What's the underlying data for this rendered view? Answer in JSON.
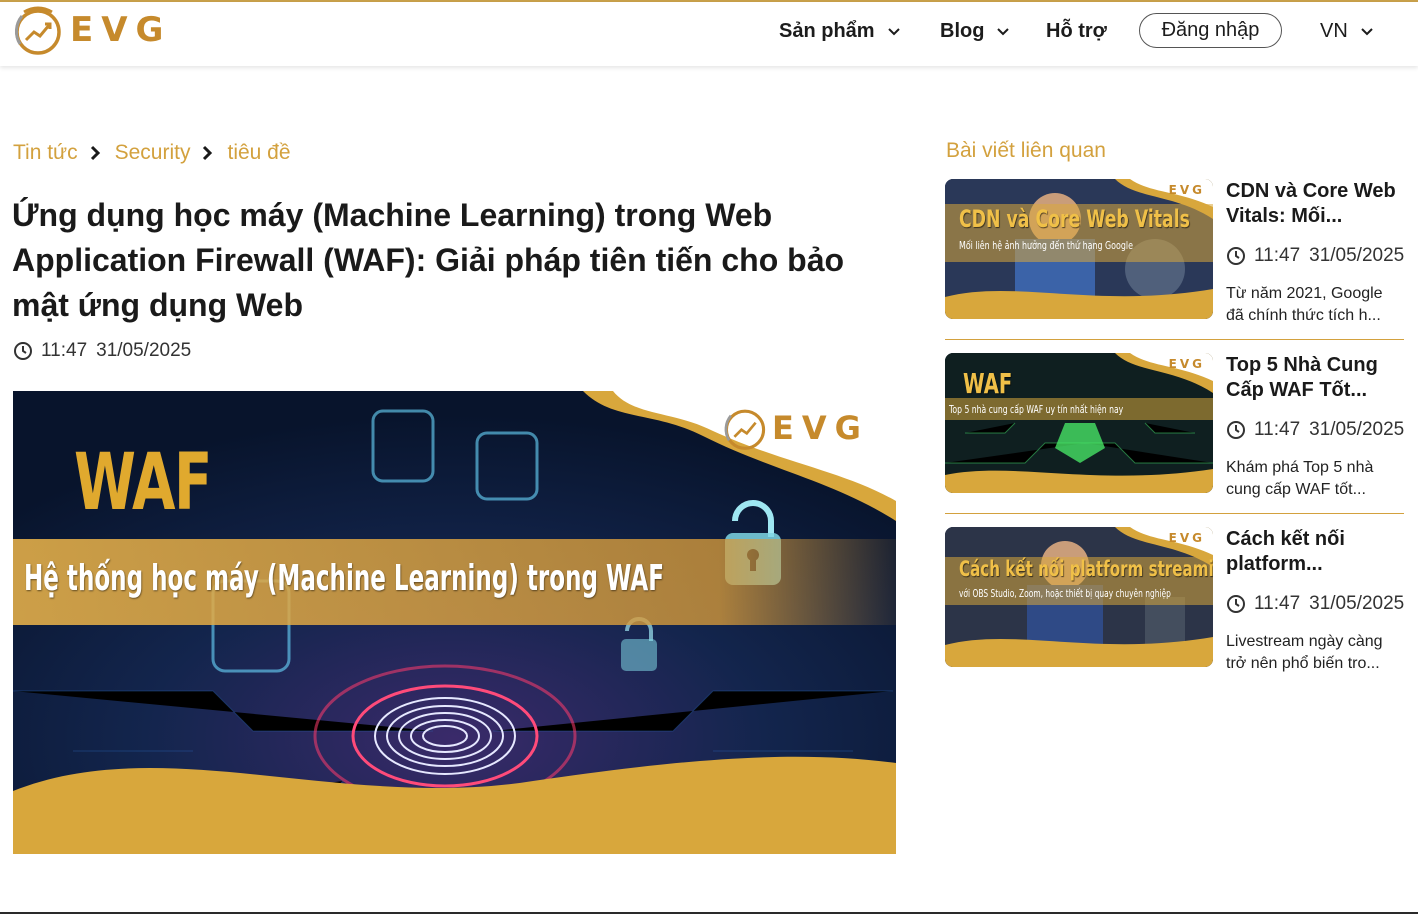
{
  "brand": {
    "logo_text": "EVG",
    "accent_color": "#d3a13e",
    "gold": "#c68a2c"
  },
  "nav": {
    "products": "Sản phẩm",
    "blog": "Blog",
    "support": "Hỗ trợ",
    "login": "Đăng nhập",
    "language": "VN"
  },
  "breadcrumb": {
    "items": [
      "Tin tức",
      "Security",
      "tiêu đề"
    ]
  },
  "article": {
    "title": "Ứng dụng học máy (Machine Learning) trong Web Application Firewall (WAF): Giải pháp tiên tiến cho bảo mật ứng dụng Web",
    "time": "11:47",
    "date": "31/05/2025",
    "hero": {
      "headline": "WAF",
      "banner": "Hệ thống học máy (Machine Learning) trong WAF",
      "logo_text": "EVG"
    }
  },
  "sidebar": {
    "heading": "Bài viết liên quan",
    "posts": [
      {
        "title": "CDN và Core Web Vitals: Mối...",
        "time": "11:47",
        "date": "31/05/2025",
        "excerpt": "Từ năm 2021, Google đã chính thức tích h...",
        "thumb_title": "CDN và Core Web Vitals",
        "thumb_subtitle": "Mối liên hệ ảnh hưởng đến thứ hạng Google",
        "thumb_logo": "EVG"
      },
      {
        "title": "Top 5 Nhà Cung Cấp WAF Tốt...",
        "time": "11:47",
        "date": "31/05/2025",
        "excerpt": "Khám phá Top 5 nhà cung cấp WAF tốt...",
        "thumb_title": "WAF",
        "thumb_subtitle": "Top 5 nhà cung cấp WAF uy tín nhất hiện nay",
        "thumb_logo": "EVG"
      },
      {
        "title": "Cách kết nối platform...",
        "time": "11:47",
        "date": "31/05/2025",
        "excerpt": "Livestream ngày càng trở nên phổ biến tro...",
        "thumb_title": "Cách kết nối platform streaming",
        "thumb_subtitle": "với OBS Studio, Zoom, hoặc thiết bị quay chuyên nghiệp",
        "thumb_logo": "EVG"
      }
    ]
  }
}
